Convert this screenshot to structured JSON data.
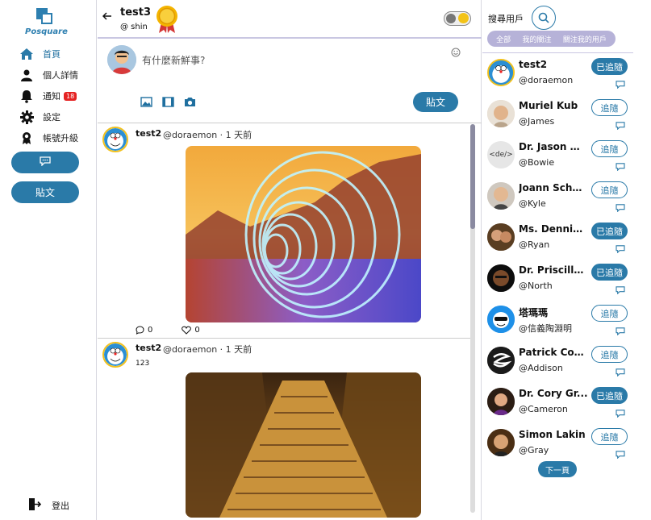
{
  "app": {
    "logo_text": "Posquare"
  },
  "nav": {
    "items": [
      {
        "label": "首頁",
        "icon": "home-icon"
      },
      {
        "label": "個人詳情",
        "icon": "user-icon"
      },
      {
        "label": "通知",
        "icon": "bell-icon",
        "badge": "18"
      },
      {
        "label": "設定",
        "icon": "gear-icon"
      },
      {
        "label": "帳號升級",
        "icon": "award-icon"
      }
    ],
    "post_button": "貼文",
    "logout": "登出"
  },
  "header": {
    "name": "test3",
    "handle": "@ shin"
  },
  "composer": {
    "placeholder": "有什麼新鮮事?",
    "post_button": "貼文"
  },
  "posts": [
    {
      "name": "test2",
      "handle": "@doraemon · 1 天前",
      "text": "",
      "comments": "0",
      "likes": "0"
    },
    {
      "name": "test2",
      "handle": "@doraemon · 1 天前",
      "text": "123"
    }
  ],
  "right": {
    "search_label": "搜尋用戶",
    "tabs": [
      "全部",
      "我的關注",
      "關注我的用戶"
    ],
    "users": [
      {
        "name": "test2",
        "handle": "@doraemon",
        "follow": "已追隨",
        "following": true
      },
      {
        "name": "Muriel Kub",
        "handle": "@James",
        "follow": "追隨",
        "following": false
      },
      {
        "name": "Dr. Jason M...",
        "handle": "@Bowie",
        "follow": "追隨",
        "following": false
      },
      {
        "name": "Joann Schoen",
        "handle": "@Kyle",
        "follow": "追隨",
        "following": false
      },
      {
        "name": "Ms. Dennis ...",
        "handle": "@Ryan",
        "follow": "已追隨",
        "following": true
      },
      {
        "name": "Dr. Priscilla...",
        "handle": "@North",
        "follow": "已追隨",
        "following": true
      },
      {
        "name": "塔瑪瑪",
        "handle": "@信義陶淵明",
        "follow": "追隨",
        "following": false
      },
      {
        "name": "Patrick Con...",
        "handle": "@Addison",
        "follow": "追隨",
        "following": false
      },
      {
        "name": "Dr. Cory Gr...",
        "handle": "@Cameron",
        "follow": "已追隨",
        "following": true
      },
      {
        "name": "Simon Lakin",
        "handle": "@Gray",
        "follow": "追隨",
        "following": false
      }
    ],
    "next_page": "下一頁"
  },
  "colors": {
    "accent": "#2a7aa8",
    "tab_bg": "#b6b2d8",
    "badge": "#e52323"
  }
}
